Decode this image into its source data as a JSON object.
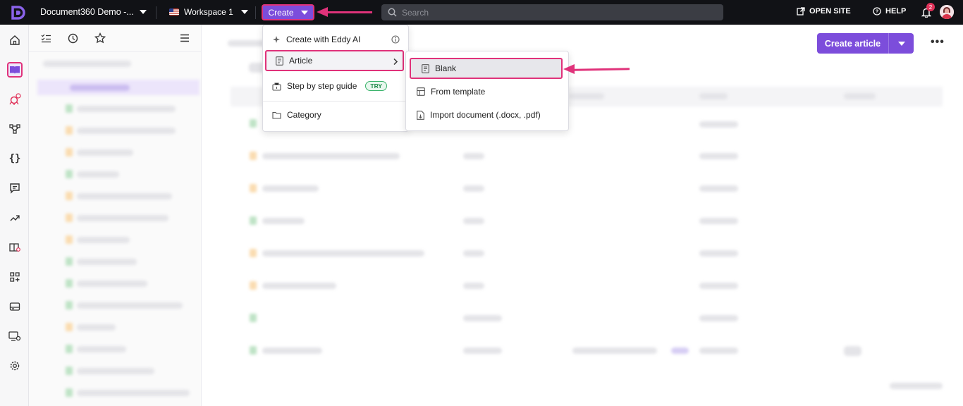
{
  "topbar": {
    "project_name": "Document360 Demo -...",
    "workspace": "Workspace 1",
    "create_label": "Create",
    "search_placeholder": "Search",
    "open_site": "OPEN SITE",
    "help": "HELP",
    "notification_count": "2"
  },
  "create_menu": {
    "items": [
      {
        "label": "Create with Eddy AI",
        "icon": "sparkle-icon"
      },
      {
        "label": "Article",
        "icon": "document-icon"
      },
      {
        "label": "Step by step guide",
        "icon": "guide-icon",
        "badge": "TRY"
      },
      {
        "label": "Category",
        "icon": "folder-icon"
      }
    ]
  },
  "article_submenu": {
    "items": [
      {
        "label": "Blank",
        "icon": "blank-document-icon"
      },
      {
        "label": "From template",
        "icon": "template-icon"
      },
      {
        "label": "Import document (.docx, .pdf)",
        "icon": "import-icon"
      }
    ]
  },
  "main": {
    "create_article_label": "Create article"
  },
  "colors": {
    "accent": "#7c4ddb",
    "highlight": "#e0327a",
    "topbar": "#111216"
  }
}
